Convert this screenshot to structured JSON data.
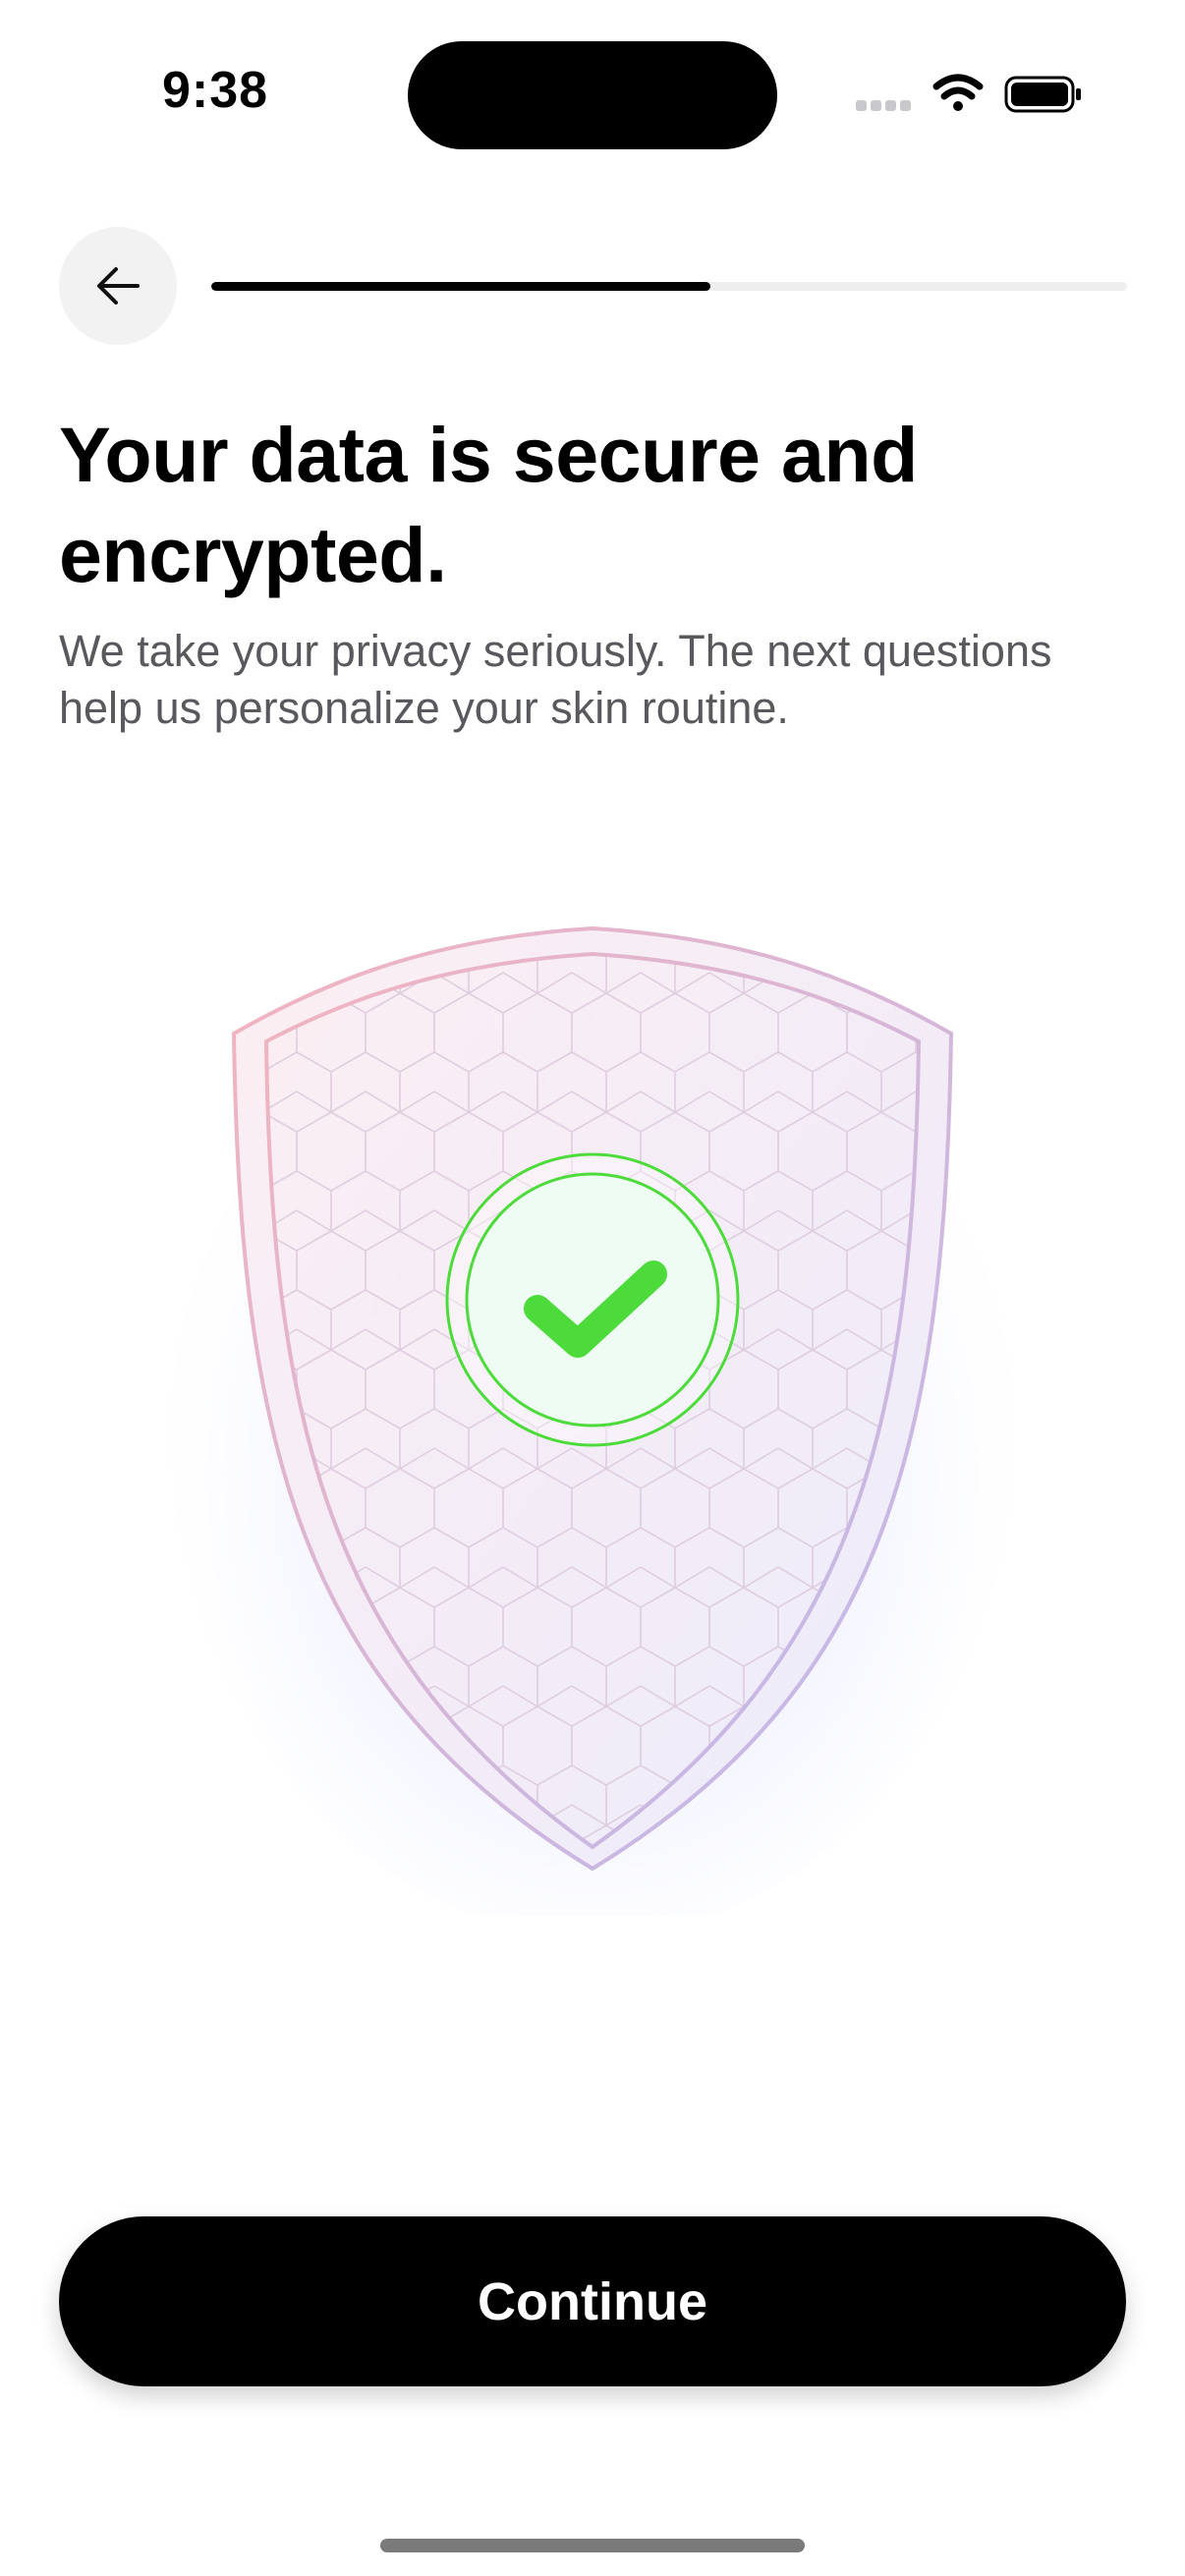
{
  "status_bar": {
    "time": "9:38",
    "icons": [
      "cellular-signal-icon",
      "wifi-icon",
      "battery-icon"
    ]
  },
  "header": {
    "back_icon": "arrow-left-icon",
    "progress": 0.545
  },
  "content": {
    "title": "Your data is secure and encrypted.",
    "subtitle": "We take your privacy seriously. The next questions help us personalize your skin routine."
  },
  "illustration": {
    "shield_icon": "shield-icon",
    "check_icon": "checkmark-icon",
    "check_color": "#4cdb3a",
    "shield_gradient": [
      "#f2b3bf",
      "#bdb9ef"
    ]
  },
  "footer": {
    "continue_label": "Continue"
  },
  "colors": {
    "primary": "#000000",
    "background": "#ffffff",
    "subtitle": "#58585d",
    "back_button_bg": "#f2f2f2",
    "progress_track": "#eeeeee"
  }
}
